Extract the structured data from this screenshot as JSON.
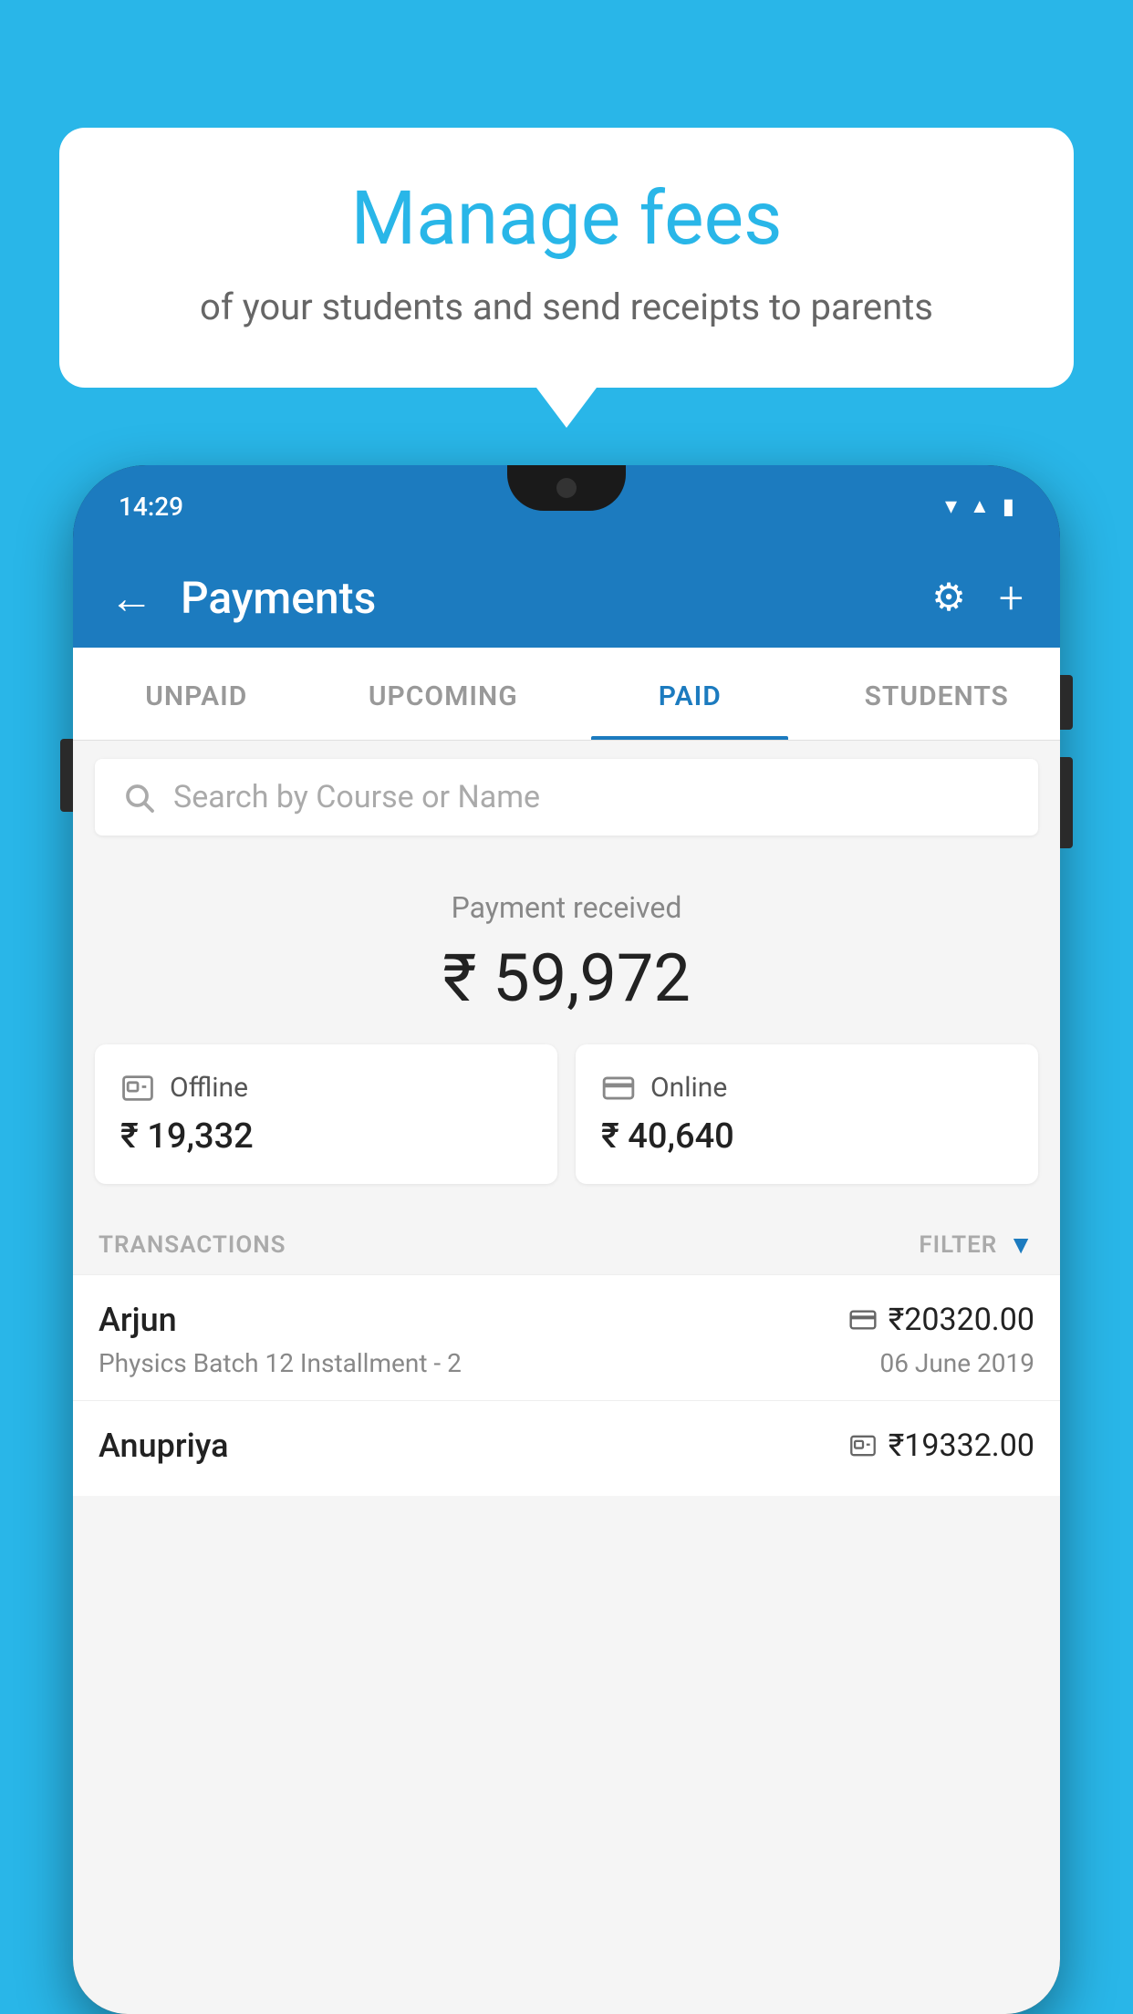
{
  "background_color": "#29b6e8",
  "bubble": {
    "title": "Manage fees",
    "subtitle": "of your students and send receipts to parents"
  },
  "phone": {
    "status_bar": {
      "time": "14:29"
    },
    "header": {
      "title": "Payments",
      "back_label": "←",
      "gear_label": "⚙",
      "plus_label": "+"
    },
    "tabs": [
      {
        "label": "UNPAID",
        "active": false
      },
      {
        "label": "UPCOMING",
        "active": false
      },
      {
        "label": "PAID",
        "active": true
      },
      {
        "label": "STUDENTS",
        "active": false
      }
    ],
    "search": {
      "placeholder": "Search by Course or Name"
    },
    "payment_received": {
      "label": "Payment received",
      "amount": "₹ 59,972"
    },
    "offline_card": {
      "label": "Offline",
      "amount": "₹ 19,332"
    },
    "online_card": {
      "label": "Online",
      "amount": "₹ 40,640"
    },
    "transactions_label": "TRANSACTIONS",
    "filter_label": "FILTER",
    "transactions": [
      {
        "name": "Arjun",
        "course": "Physics Batch 12 Installment - 2",
        "amount": "₹20320.00",
        "date": "06 June 2019",
        "payment_type": "online"
      },
      {
        "name": "Anupriya",
        "course": "",
        "amount": "₹19332.00",
        "date": "",
        "payment_type": "offline"
      }
    ]
  }
}
